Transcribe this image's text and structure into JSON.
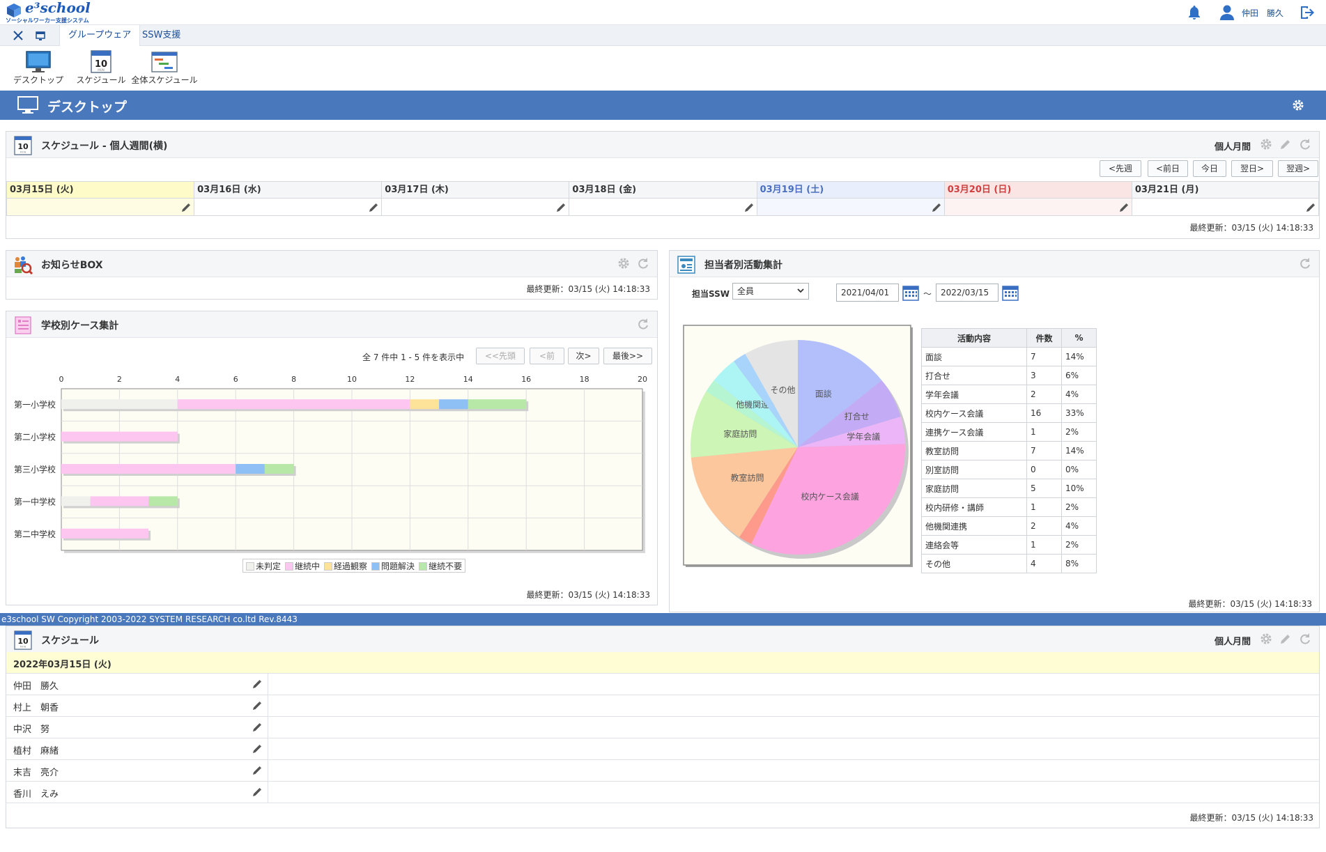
{
  "header": {
    "logo_text": "e³school",
    "logo_subtitle": "ソーシャルワーカー支援システム",
    "user_name": "仲田　勝久"
  },
  "tabs": [
    {
      "label": "グループウェア"
    },
    {
      "label": "SSW支援"
    }
  ],
  "launcher": [
    {
      "label": "デスクトップ",
      "icon": "monitor-icon"
    },
    {
      "label": "スケジュール",
      "icon": "calendar-icon"
    },
    {
      "label": "全体スケジュール",
      "icon": "gantt-icon"
    }
  ],
  "page_title": "デスクトップ",
  "weekly": {
    "title": "スケジュール - 個人週間(横)",
    "mode_label": "個人月間",
    "nav": [
      "<先週",
      "<前日",
      "今日",
      "翌日>",
      "翌週>"
    ],
    "days": [
      {
        "label": "03月15日 (火)",
        "kind": "today"
      },
      {
        "label": "03月16日 (水)",
        "kind": "normal"
      },
      {
        "label": "03月17日 (木)",
        "kind": "normal"
      },
      {
        "label": "03月18日 (金)",
        "kind": "normal"
      },
      {
        "label": "03月19日 (土)",
        "kind": "sat"
      },
      {
        "label": "03月20日 (日)",
        "kind": "sun"
      },
      {
        "label": "03月21日 (月)",
        "kind": "normal"
      }
    ],
    "updated": "最終更新：03/15 (火) 14:18:33"
  },
  "notice": {
    "title": "お知らせBOX",
    "updated": "最終更新：03/15 (火) 14:18:33"
  },
  "school_cases": {
    "title": "学校別ケース集計",
    "paging_info": "全 7 件中 1 - 5 件を表示中",
    "buttons": [
      "<<先頭",
      "<前",
      "次>",
      "最後>>"
    ],
    "updated": "最終更新：03/15 (火) 14:18:33"
  },
  "activity": {
    "title": "担当者別活動集計",
    "ssw_label": "担当SSW",
    "ssw_value": "全員",
    "date_from": "2021/04/01",
    "tilde": "～",
    "date_to": "2022/03/15",
    "table_headers": [
      "活動内容",
      "件数",
      "%"
    ],
    "rows": [
      [
        "面談",
        "7",
        "14%"
      ],
      [
        "打合せ",
        "3",
        "6%"
      ],
      [
        "学年会議",
        "2",
        "4%"
      ],
      [
        "校内ケース会議",
        "16",
        "33%"
      ],
      [
        "連携ケース会議",
        "1",
        "2%"
      ],
      [
        "教室訪問",
        "7",
        "14%"
      ],
      [
        "別室訪問",
        "0",
        "0%"
      ],
      [
        "家庭訪問",
        "5",
        "10%"
      ],
      [
        "校内研修・講師",
        "1",
        "2%"
      ],
      [
        "他機関連携",
        "2",
        "4%"
      ],
      [
        "連絡会等",
        "1",
        "2%"
      ],
      [
        "その他",
        "4",
        "8%"
      ]
    ],
    "updated": "最終更新：03/15 (火) 14:18:33"
  },
  "footer": "e3school SW Copyright 2003-2022 SYSTEM RESEARCH co.ltd Rev.8443",
  "daily": {
    "title": "スケジュール",
    "mode_label": "個人月間",
    "date": "2022年03月15日 (火)",
    "people": [
      "仲田　勝久",
      "村上　朝香",
      "中沢　努",
      "植村　麻緒",
      "末吉　亮介",
      "香川　えみ"
    ],
    "updated": "最終更新：03/15 (火) 14:18:33"
  },
  "chart_data": [
    {
      "type": "bar",
      "stacked": true,
      "orientation": "horizontal",
      "categories": [
        "第一小学校",
        "第二小学校",
        "第三小学校",
        "第一中学校",
        "第二中学校"
      ],
      "xlim": [
        0,
        20
      ],
      "xticks": [
        "0",
        "2",
        "4",
        "6",
        "8",
        "10",
        "12",
        "14",
        "16",
        "18",
        "20"
      ],
      "series": [
        {
          "name": "未判定",
          "color": "#f0f0ec",
          "values": [
            4,
            0,
            0,
            1,
            0
          ]
        },
        {
          "name": "継続中",
          "color": "#fdc6f0",
          "values": [
            8,
            4,
            6,
            2,
            3
          ]
        },
        {
          "name": "経過観察",
          "color": "#fde39a",
          "values": [
            1,
            0,
            0,
            0,
            0
          ]
        },
        {
          "name": "問題解決",
          "color": "#8fc0f5",
          "values": [
            1,
            0,
            1,
            0,
            0
          ]
        },
        {
          "name": "継続不要",
          "color": "#b8e8a8",
          "values": [
            2,
            0,
            1,
            1,
            0
          ]
        }
      ],
      "legend": "bottom",
      "grid": true
    },
    {
      "type": "pie",
      "slices": [
        {
          "label": "面談",
          "value": 7,
          "color": "#b3bffb"
        },
        {
          "label": "打合せ",
          "value": 3,
          "color": "#c3acf5"
        },
        {
          "label": "学年会議",
          "value": 2,
          "color": "#ebb5f8"
        },
        {
          "label": "校内ケース会議",
          "value": 16,
          "color": "#fca3e0"
        },
        {
          "label": "連携ケース会議",
          "value": 1,
          "color": "#fd9a8c"
        },
        {
          "label": "教室訪問",
          "value": 7,
          "color": "#fdc79e"
        },
        {
          "label": "別室訪問",
          "value": 0,
          "color": "#f7e6a6"
        },
        {
          "label": "家庭訪問",
          "value": 5,
          "color": "#cdf5b5"
        },
        {
          "label": "校内研修・講師",
          "value": 1,
          "color": "#b6f5d2"
        },
        {
          "label": "他機関連携",
          "value": 2,
          "color": "#adf5f5"
        },
        {
          "label": "連絡会等",
          "value": 1,
          "color": "#a8d3fb"
        },
        {
          "label": "その他",
          "value": 4,
          "color": "#e4e4e4"
        }
      ],
      "shown_labels": [
        "面談",
        "打合せ",
        "学年会議",
        "校内ケース会議",
        "教室訪問",
        "家庭訪問",
        "他機関連携",
        "その他"
      ]
    }
  ]
}
